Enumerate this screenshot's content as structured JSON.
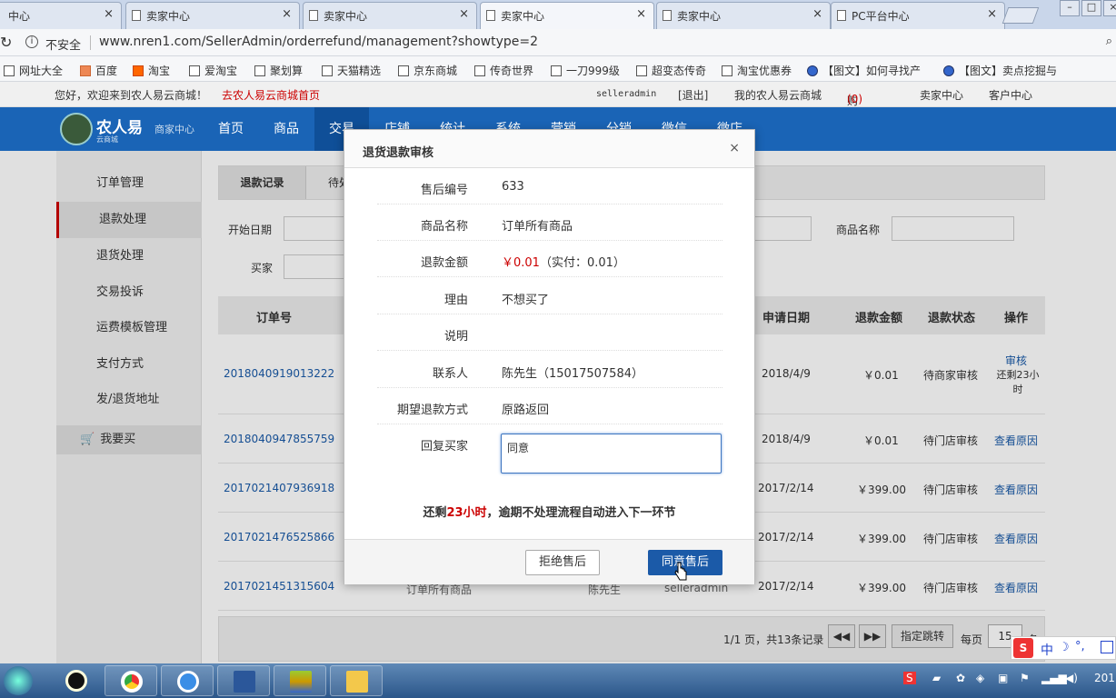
{
  "browser": {
    "tabs": [
      {
        "label": "中心",
        "active": false
      },
      {
        "label": "卖家中心",
        "active": false
      },
      {
        "label": "卖家中心",
        "active": false
      },
      {
        "label": "卖家中心",
        "active": true
      },
      {
        "label": "卖家中心",
        "active": false
      },
      {
        "label": "PC平台中心",
        "active": false
      }
    ],
    "security_label": "不安全",
    "url": "www.nren1.com/SellerAdmin/orderrefund/management?showtype=2",
    "bookmarks": [
      "网址大全",
      "百度",
      "淘宝",
      "爱淘宝",
      "聚划算",
      "天猫精选",
      "京东商城",
      "传奇世界",
      "一刀999级",
      "超变态传奇",
      "淘宝优惠券",
      "【图文】如何寻找产",
      "【图文】卖点挖掘与"
    ]
  },
  "topbar": {
    "welcome": "您好，欢迎来到农人易云商城！",
    "home_link": "去农人易云商城首页",
    "username": "selleradmin",
    "logout": "[退出]",
    "my_store": "我的农人易云商城",
    "cart": "购物车",
    "cart_count": "(0)",
    "seller_center": "卖家中心",
    "customer_service": "客户中心"
  },
  "nav": {
    "brand": "农人易",
    "brand_sub": "云商城",
    "center": "商家中心",
    "items": [
      "首页",
      "商品",
      "交易",
      "店铺",
      "统计",
      "系统",
      "营销",
      "分销",
      "微信",
      "微店"
    ],
    "active_index": 2
  },
  "sidebar": {
    "items": [
      "订单管理",
      "退款处理",
      "退货处理",
      "交易投诉",
      "运费模板管理",
      "支付方式",
      "发/退货地址"
    ],
    "active_index": 1,
    "want_buy": "我要买"
  },
  "content": {
    "tab_records": "退款记录",
    "tab_pending": "待处",
    "filters": {
      "start_date": "开始日期",
      "product_name": "商品名称",
      "buyer": "买家"
    },
    "columns": [
      "订单号",
      "申请日期",
      "退款金额",
      "退款状态",
      "操作"
    ],
    "rows": [
      {
        "order": "2018040919013222",
        "product": "",
        "buyer": "",
        "shop": "",
        "date": "2018/4/9",
        "amount": "￥0.01",
        "status": "待商家审核",
        "action": "审核",
        "note": "还剩23小时"
      },
      {
        "order": "2018040947855759",
        "product": "",
        "buyer": "",
        "shop": "",
        "date": "2018/4/9",
        "amount": "￥0.01",
        "status": "待门店审核",
        "action": "查看原因",
        "note": ""
      },
      {
        "order": "2017021407936918",
        "product": "",
        "buyer": "",
        "shop": "",
        "date": "2017/2/14",
        "amount": "￥399.00",
        "status": "待门店审核",
        "action": "查看原因",
        "note": ""
      },
      {
        "order": "2017021476525866",
        "product": "",
        "buyer": "",
        "shop": "",
        "date": "2017/2/14",
        "amount": "￥399.00",
        "status": "待门店审核",
        "action": "查看原因",
        "note": ""
      },
      {
        "order": "2017021451315604",
        "product": "订单所有商品",
        "buyer": "陈先生",
        "shop": "selleradmin",
        "date": "2017/2/14",
        "amount": "￥399.00",
        "status": "待门店审核",
        "action": "查看原因",
        "note": ""
      }
    ],
    "pager": {
      "summary": "1/1 页，共13条记录",
      "jump": "指定跳转",
      "per_page_label": "每页",
      "per_page": "15",
      "unit": "条"
    }
  },
  "modal": {
    "title": "退货退款审核",
    "fields": [
      {
        "label": "售后编号",
        "value": "633"
      },
      {
        "label": "商品名称",
        "value": "订单所有商品"
      },
      {
        "label": "退款金额",
        "value": "￥0.01",
        "extra": "（实付：0.01）"
      },
      {
        "label": "理由",
        "value": "不想买了"
      },
      {
        "label": "说明",
        "value": ""
      },
      {
        "label": "联系人",
        "value": "陈先生（15017507584）"
      },
      {
        "label": "期望退款方式",
        "value": "原路返回"
      }
    ],
    "reply_label": "回复买家",
    "reply_value": "同意",
    "warn_prefix": "还剩",
    "warn_time": "23小时",
    "warn_suffix": "，逾期不处理流程自动进入下一环节",
    "reject_label": "拒绝售后",
    "agree_label": "同意售后"
  },
  "taskbar": {
    "ime": "中",
    "year": "201"
  }
}
